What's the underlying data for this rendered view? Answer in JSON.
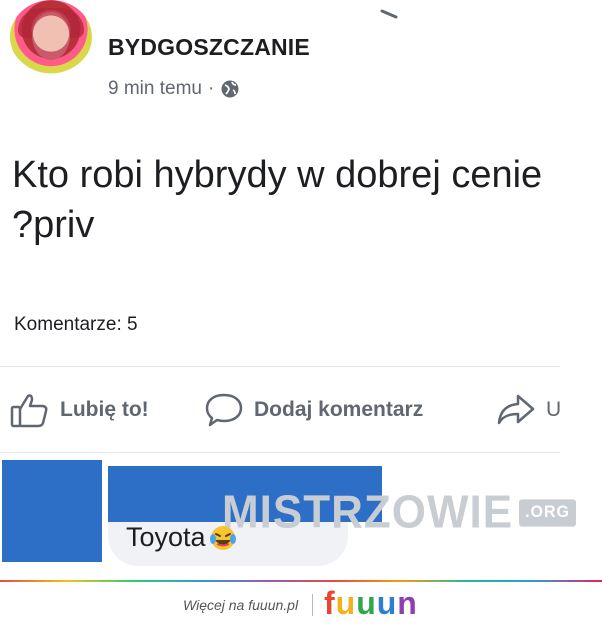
{
  "post": {
    "page_name": "BYDGOSZCZANIE",
    "time": "9 min temu",
    "separator": "·",
    "text": "Kto robi hybrydy w dobrej cenie ?priv",
    "comments_count": "Komentarze: 5"
  },
  "actions": {
    "like_label": "Lubię to!",
    "comment_label": "Dodaj komentarz",
    "share_label": "U"
  },
  "comment": {
    "text": "Toyota"
  },
  "watermark": {
    "text": "MISTRZOWIE",
    "suffix": ".ORG"
  },
  "footer": {
    "link_text": "Więcej na fuuun.pl",
    "logo_letters": [
      "f",
      "u",
      "u",
      "u",
      "n"
    ],
    "logo_colors": [
      "#e8462f",
      "#f3b21a",
      "#2ea84a",
      "#2f7fd0",
      "#8e3fb0"
    ]
  }
}
